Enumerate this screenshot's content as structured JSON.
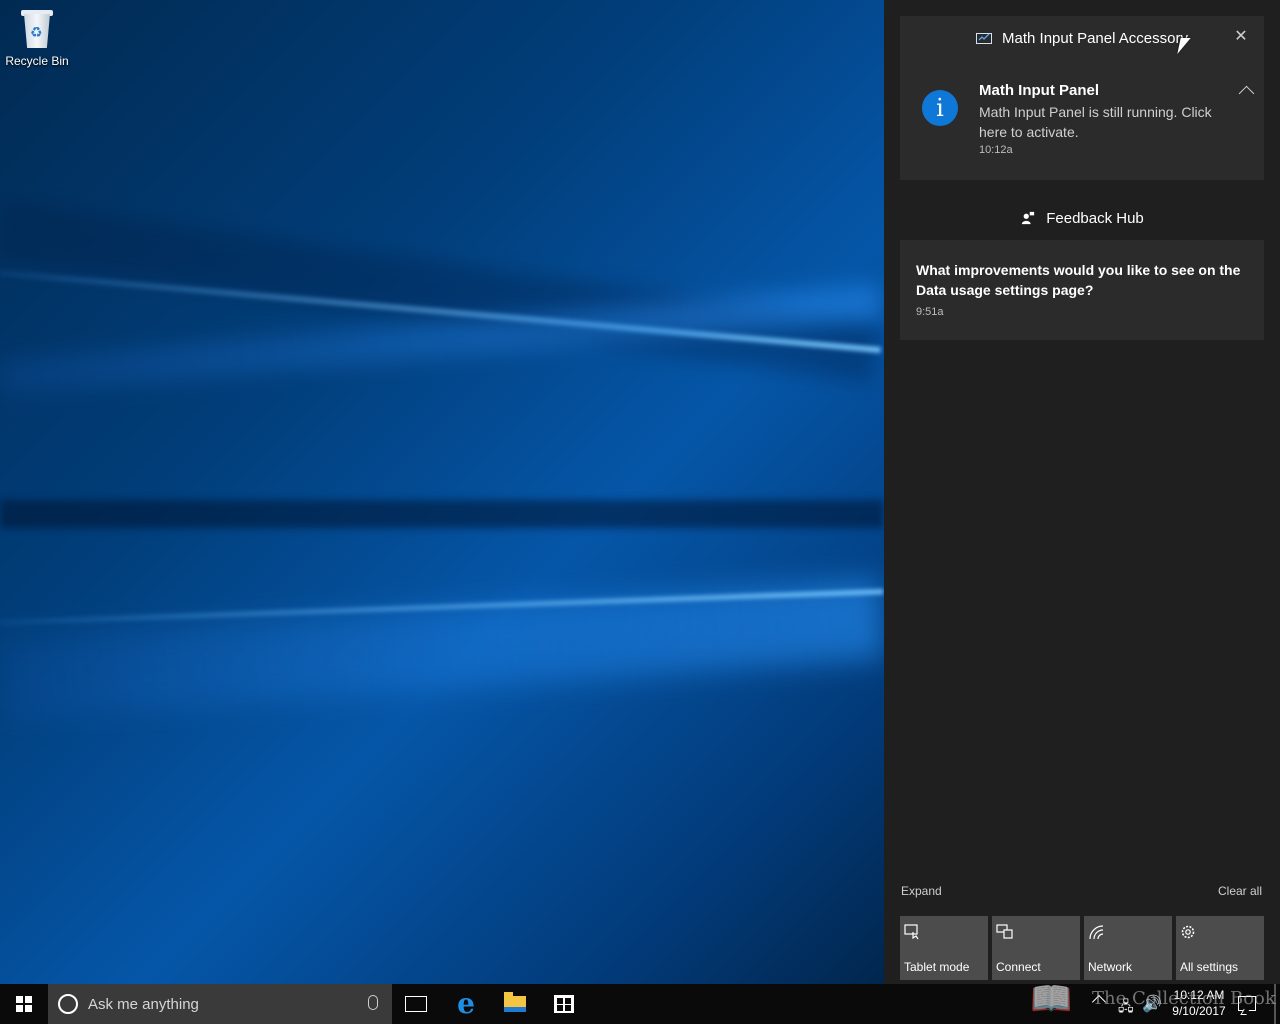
{
  "desktop": {
    "icons": [
      {
        "label": "Recycle Bin",
        "icon": "recycle-bin-icon"
      }
    ]
  },
  "action_center": {
    "groups": [
      {
        "app_name": "Math Input Panel Accessory",
        "icon": "math-input-panel-icon",
        "notification": {
          "title": "Math Input Panel",
          "body": "Math Input Panel is still running. Click here to activate.",
          "time": "10:12a",
          "icon": "info-icon"
        }
      },
      {
        "app_name": "Feedback Hub",
        "icon": "feedback-hub-icon",
        "notification": {
          "body": "What improvements would you like to see on the Data usage settings page?",
          "time": "9:51a"
        }
      }
    ],
    "expand_label": "Expand",
    "clear_all_label": "Clear all",
    "quick_actions": [
      {
        "label": "Tablet mode",
        "icon": "tablet-mode-icon"
      },
      {
        "label": "Connect",
        "icon": "connect-icon"
      },
      {
        "label": "Network",
        "icon": "network-icon"
      },
      {
        "label": "All settings",
        "icon": "gear-icon"
      }
    ]
  },
  "taskbar": {
    "search_placeholder": "Ask me anything",
    "pinned": [
      "task-view-icon",
      "edge-icon",
      "file-explorer-icon",
      "store-icon"
    ],
    "clock_time": "10:12 AM",
    "clock_date": "9/10/2017"
  },
  "watermark": {
    "text": "The Collection Book"
  },
  "colors": {
    "accent": "#0f78d7",
    "panel": "#1f1f1f",
    "card": "#2b2b2b",
    "tile": "#4c4c4c"
  }
}
